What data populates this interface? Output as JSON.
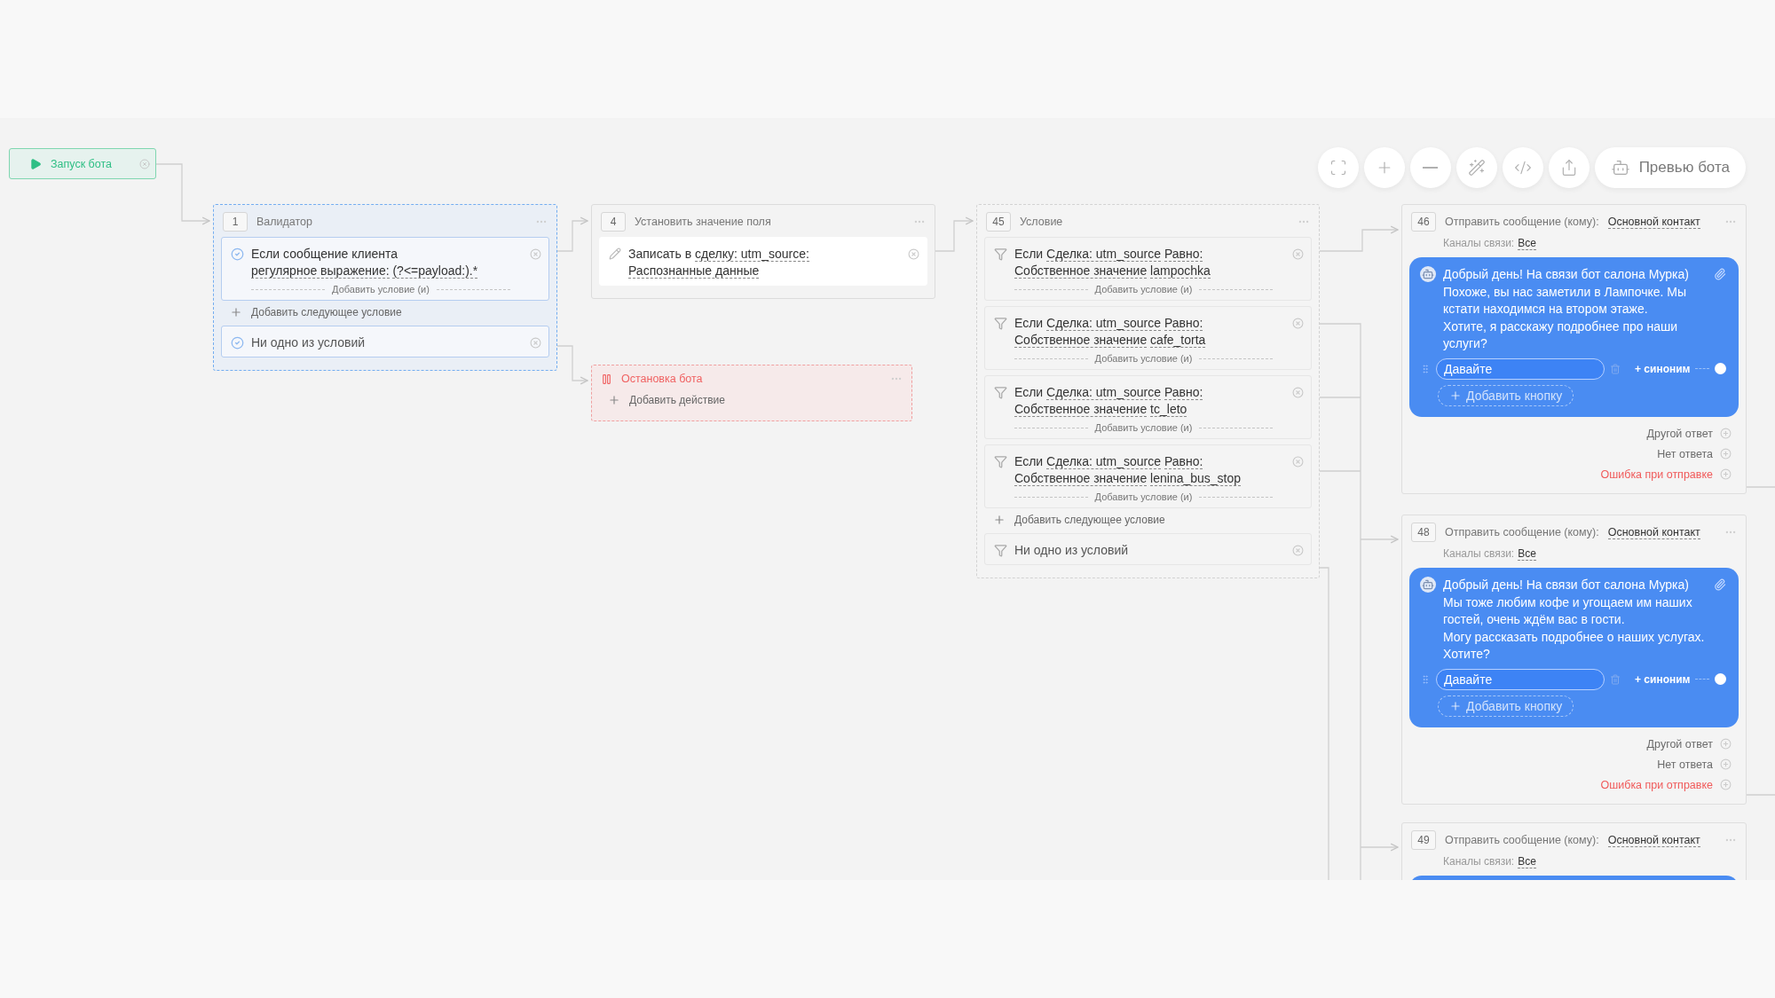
{
  "toolbar": {
    "buttons": [
      {
        "kind": "fit"
      },
      {
        "kind": "zoom_in"
      },
      {
        "kind": "zoom_out"
      },
      {
        "kind": "wand"
      },
      {
        "kind": "code"
      },
      {
        "kind": "export"
      }
    ],
    "preview_label": "Превью бота"
  },
  "start": {
    "label": "Запуск бота"
  },
  "nodes": [
    {
      "kind": "validator",
      "number": "1",
      "title": "Валидатор",
      "selected": true,
      "rules": [
        {
          "prefix": "Если сообщение клиента",
          "operator": "регулярное выражение:",
          "value": "(?<=payload:).*",
          "add_label": "Добавить условие (и)"
        }
      ],
      "add_next": "Добавить следующее условие",
      "fallback": "Ни одно из условий"
    },
    {
      "kind": "set_field",
      "number": "4",
      "title": "Установить значение поля",
      "selected": false,
      "actions": [
        {
          "prefix": "Записать в",
          "target": "сделку: utm_source:",
          "value": "Распознанные данные"
        }
      ]
    },
    {
      "kind": "stop",
      "title": "Остановка бота",
      "selected": false,
      "add_action": "Добавить действие"
    },
    {
      "kind": "condition",
      "number": "45",
      "title": "Условие",
      "selected": false,
      "rules": [
        {
          "prefix": "Если",
          "field": "Сделка: utm_source",
          "operator": "Равно:",
          "value_type": "Собственное значение",
          "value": "lampochka",
          "add_label": "Добавить условие (и)"
        },
        {
          "prefix": "Если",
          "field": "Сделка: utm_source",
          "operator": "Равно:",
          "value_type": "Собственное значение",
          "value": "cafe_torta",
          "add_label": "Добавить условие (и)"
        },
        {
          "prefix": "Если",
          "field": "Сделка: utm_source",
          "operator": "Равно:",
          "value_type": "Собственное значение",
          "value": "tc_leto",
          "add_label": "Добавить условие (и)"
        },
        {
          "prefix": "Если",
          "field": "Сделка: utm_source",
          "operator": "Равно:",
          "value_type": "Собственное значение",
          "value": "lenina_bus_stop",
          "add_label": "Добавить условие (и)"
        }
      ],
      "add_next": "Добавить следующее условие",
      "fallback": "Ни одно из условий"
    },
    {
      "kind": "message",
      "number": "46",
      "title": "Отправить сообщение (кому):",
      "recipient": "Основной контакт",
      "channels_label": "Каналы связи:",
      "channels": "Все",
      "selected": false,
      "message": "Добрый день! На связи бот салона Мурка)\nПохоже, вы нас заметили в Лампочке. Мы кстати находимся на втором этаже.\nХотите, я расскажу подробнее про наши услуги?",
      "buttons": [
        {
          "label": "Давайте",
          "synonym": "+ синоним"
        }
      ],
      "add_button": "Добавить кнопку",
      "outputs": [
        {
          "label": "Другой ответ",
          "kind": "normal"
        },
        {
          "label": "Нет ответа",
          "kind": "normal"
        },
        {
          "label": "Ошибка при отправке",
          "kind": "error"
        }
      ]
    },
    {
      "kind": "message",
      "number": "48",
      "title": "Отправить сообщение (кому):",
      "recipient": "Основной контакт",
      "channels_label": "Каналы связи:",
      "channels": "Все",
      "selected": false,
      "message": "Добрый день! На связи бот салона Мурка)\nМы тоже любим кофе и угощаем им наших гостей, очень ждём вас в гости.\nМогу рассказать подробнее о наших услугах. Хотите?",
      "buttons": [
        {
          "label": "Давайте",
          "synonym": "+ синоним"
        }
      ],
      "add_button": "Добавить кнопку",
      "outputs": [
        {
          "label": "Другой ответ",
          "kind": "normal"
        },
        {
          "label": "Нет ответа",
          "kind": "normal"
        },
        {
          "label": "Ошибка при отправке",
          "kind": "error"
        }
      ]
    },
    {
      "kind": "message",
      "number": "49",
      "title": "Отправить сообщение (кому):",
      "recipient": "Основной контакт",
      "channels_label": "Каналы связи:",
      "channels": "Все",
      "selected": false
    }
  ]
}
